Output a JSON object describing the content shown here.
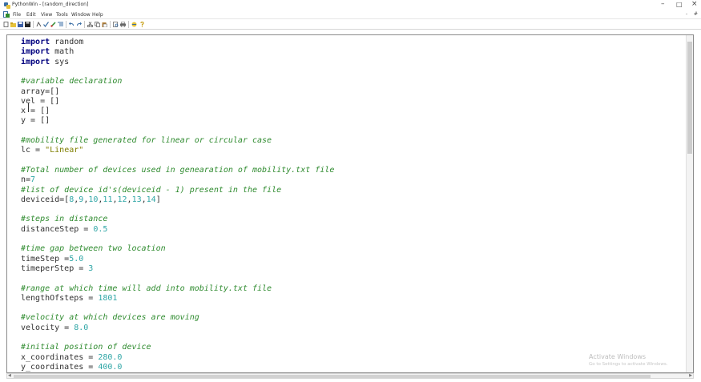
{
  "window": {
    "title": "PythonWin - [random_direction]",
    "controls": {
      "minimize": "–",
      "maximize": "□",
      "close": "×"
    }
  },
  "menubar": {
    "items": [
      "File",
      "Edit",
      "View",
      "Tools",
      "Window",
      "Help"
    ],
    "mdi_controls": {
      "restore": "-",
      "close": "#"
    }
  },
  "toolbar": {
    "icons": [
      "new-file-icon",
      "open-folder-icon",
      "save-icon",
      "save-all-icon",
      "cut-icon",
      "check-icon",
      "run-icon",
      "indent-icon",
      "undo-icon",
      "redo-icon",
      "scissors-icon",
      "copy-icon",
      "paste-icon",
      "print-preview-icon",
      "print-icon",
      "browser-icon",
      "help-icon"
    ]
  },
  "editor": {
    "lines": [
      {
        "tokens": [
          {
            "t": "kw",
            "v": "import"
          },
          {
            "t": "tx",
            "v": " random"
          }
        ]
      },
      {
        "tokens": [
          {
            "t": "kw",
            "v": "import"
          },
          {
            "t": "tx",
            "v": " math"
          }
        ]
      },
      {
        "tokens": [
          {
            "t": "kw",
            "v": "import"
          },
          {
            "t": "tx",
            "v": " sys"
          }
        ]
      },
      {
        "tokens": []
      },
      {
        "tokens": [
          {
            "t": "cm",
            "v": "#variable declaration"
          }
        ]
      },
      {
        "tokens": [
          {
            "t": "tx",
            "v": "array=[]"
          }
        ]
      },
      {
        "tokens": [
          {
            "t": "tx",
            "v": "vel = []"
          }
        ]
      },
      {
        "tokens": [
          {
            "t": "tx",
            "v": "x = []"
          }
        ]
      },
      {
        "tokens": [
          {
            "t": "tx",
            "v": "y = []"
          }
        ]
      },
      {
        "tokens": []
      },
      {
        "tokens": [
          {
            "t": "cm",
            "v": "#mobility file generated for linear or circular case"
          }
        ]
      },
      {
        "tokens": [
          {
            "t": "tx",
            "v": "lc = "
          },
          {
            "t": "str",
            "v": "\"Linear\""
          }
        ]
      },
      {
        "tokens": []
      },
      {
        "tokens": [
          {
            "t": "cm",
            "v": "#Total number of devices used in genearation of mobility.txt file"
          }
        ]
      },
      {
        "tokens": [
          {
            "t": "tx",
            "v": "n="
          },
          {
            "t": "num",
            "v": "7"
          }
        ]
      },
      {
        "tokens": [
          {
            "t": "cm",
            "v": "#list of device id's(deviceid - 1) present in the file"
          }
        ]
      },
      {
        "tokens": [
          {
            "t": "tx",
            "v": "deviceid=["
          },
          {
            "t": "num",
            "v": "8"
          },
          {
            "t": "tx",
            "v": ","
          },
          {
            "t": "num",
            "v": "9"
          },
          {
            "t": "tx",
            "v": ","
          },
          {
            "t": "num",
            "v": "10"
          },
          {
            "t": "tx",
            "v": ","
          },
          {
            "t": "num",
            "v": "11"
          },
          {
            "t": "tx",
            "v": ","
          },
          {
            "t": "num",
            "v": "12"
          },
          {
            "t": "tx",
            "v": ","
          },
          {
            "t": "num",
            "v": "13"
          },
          {
            "t": "tx",
            "v": ","
          },
          {
            "t": "num",
            "v": "14"
          },
          {
            "t": "tx",
            "v": "]"
          }
        ]
      },
      {
        "tokens": []
      },
      {
        "tokens": [
          {
            "t": "cm",
            "v": "#steps in distance"
          }
        ]
      },
      {
        "tokens": [
          {
            "t": "tx",
            "v": "distanceStep = "
          },
          {
            "t": "num",
            "v": "0.5"
          }
        ]
      },
      {
        "tokens": []
      },
      {
        "tokens": [
          {
            "t": "cm",
            "v": "#time gap between two location"
          }
        ]
      },
      {
        "tokens": [
          {
            "t": "tx",
            "v": "timeStep ="
          },
          {
            "t": "num",
            "v": "5.0"
          }
        ]
      },
      {
        "tokens": [
          {
            "t": "tx",
            "v": "timeperStep = "
          },
          {
            "t": "num",
            "v": "3"
          }
        ]
      },
      {
        "tokens": []
      },
      {
        "tokens": [
          {
            "t": "cm",
            "v": "#range at which time will add into mobility.txt file"
          }
        ]
      },
      {
        "tokens": [
          {
            "t": "tx",
            "v": "lengthOfsteps = "
          },
          {
            "t": "num",
            "v": "1801"
          }
        ]
      },
      {
        "tokens": []
      },
      {
        "tokens": [
          {
            "t": "cm",
            "v": "#velocity at which devices are moving"
          }
        ]
      },
      {
        "tokens": [
          {
            "t": "tx",
            "v": "velocity = "
          },
          {
            "t": "num",
            "v": "8.0"
          }
        ]
      },
      {
        "tokens": []
      },
      {
        "tokens": [
          {
            "t": "cm",
            "v": "#initial position of device"
          }
        ]
      },
      {
        "tokens": [
          {
            "t": "tx",
            "v": "x_coordinates = "
          },
          {
            "t": "num",
            "v": "280.0"
          }
        ]
      },
      {
        "tokens": [
          {
            "t": "tx",
            "v": "y_coordinates = "
          },
          {
            "t": "num",
            "v": "400.0"
          }
        ]
      }
    ]
  },
  "watermark": {
    "line1": "Activate Windows",
    "line2": "Go to Settings to activate Windows."
  },
  "colors": {
    "keyword": "#00007f",
    "comment": "#2f8b2f",
    "number": "#2fa6a6",
    "string": "#7f7f00",
    "text": "#303030"
  }
}
